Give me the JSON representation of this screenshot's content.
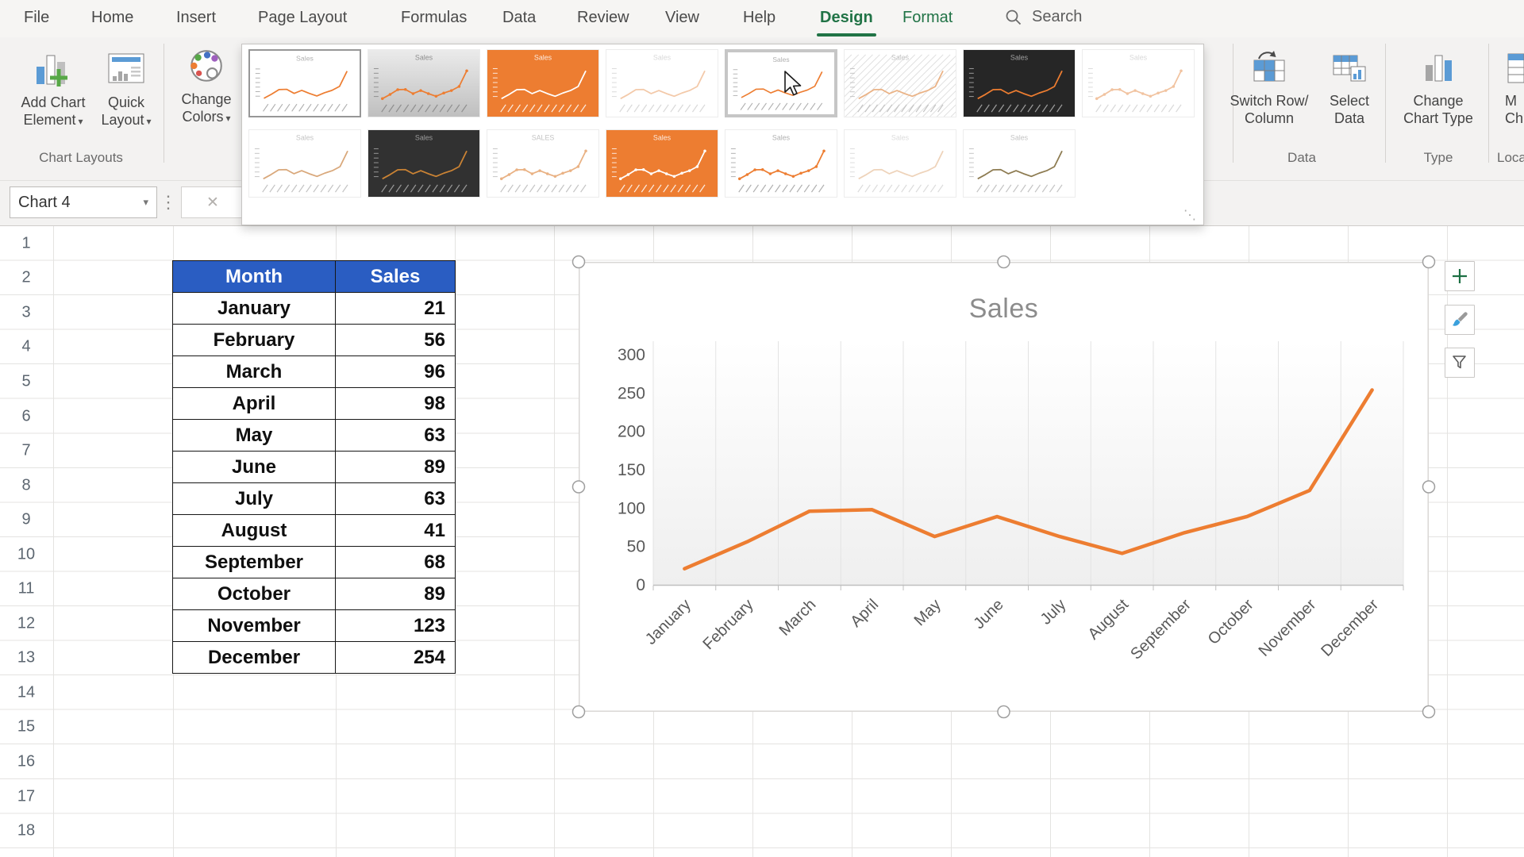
{
  "ribbon": {
    "tabs": [
      {
        "label": "File"
      },
      {
        "label": "Home"
      },
      {
        "label": "Insert"
      },
      {
        "label": "Page Layout"
      },
      {
        "label": "Formulas"
      },
      {
        "label": "Data"
      },
      {
        "label": "Review"
      },
      {
        "label": "View"
      },
      {
        "label": "Help"
      },
      {
        "label": "Design",
        "contextual": true,
        "active": true
      },
      {
        "label": "Format",
        "contextual": true
      }
    ],
    "search_label": "Search",
    "chart_layouts_group": {
      "label": "Chart Layouts",
      "add_chart_element": [
        "Add Chart",
        "Element"
      ],
      "quick_layout": [
        "Quick",
        "Layout"
      ],
      "change_colors": [
        "Change",
        "Colors"
      ]
    },
    "data_group": {
      "label": "Data",
      "switch_row_column": [
        "Switch Row/",
        "Column"
      ],
      "select_data": [
        "Select",
        "Data"
      ]
    },
    "type_group": {
      "label": "Type",
      "change_chart_type": [
        "Change",
        "Chart Type"
      ]
    },
    "location_group": {
      "label": "Loca",
      "move_chart": [
        "M",
        "Ch"
      ]
    }
  },
  "formula_bar": {
    "name_box": "Chart 4"
  },
  "icons": {
    "caret": "▾",
    "dots": "⋮",
    "cancel": "✕",
    "grip": "⋱"
  },
  "style_gallery": {
    "row1": [
      {
        "title": "Sales",
        "bg": "#ffffff",
        "line": "#ED7D31",
        "fg": "#b0b0b0",
        "state": "selected"
      },
      {
        "title": "Sales",
        "bg": "#ebebeb",
        "bg2": "#bfbfbf",
        "line": "#ED7D31",
        "fg": "#8f8f8f",
        "markers": true
      },
      {
        "title": "Sales",
        "bg": "#ED7D31",
        "line": "#ffffff",
        "fg": "rgba(255,255,255,0.85)"
      },
      {
        "title": "Sales",
        "bg": "#ffffff",
        "line": "#f3c9a9",
        "fg": "#d9d9d9"
      },
      {
        "title": "Sales",
        "bg": "#ffffff",
        "line": "#ED7D31",
        "fg": "#b0b0b0",
        "state": "hovered"
      },
      {
        "title": "Sales",
        "bg": "#ffffff",
        "line": "#eab285",
        "fg": "#c4c4c4",
        "hatch": true
      },
      {
        "title": "Sales",
        "bg": "#262626",
        "line": "#ED7D31",
        "fg": "rgba(255,255,255,0.55)"
      },
      {
        "title": "Sales",
        "bg": "#ffffff",
        "line": "#f1c3a0",
        "fg": "#d9d9d9",
        "markers": true
      }
    ],
    "row2": [
      {
        "title": "Sales",
        "bg": "#ffffff",
        "line": "#d9a87b",
        "fg": "#c4c4c4"
      },
      {
        "title": "Sales",
        "bg": "#313131",
        "line": "#cb8334",
        "fg": "rgba(255,255,255,0.5)"
      },
      {
        "title": "SALES",
        "bg": "#ffffff",
        "line": "#e9b183",
        "fg": "#c4c4c4",
        "markers": true
      },
      {
        "title": "Sales",
        "bg": "#ED7D31",
        "line": "#ffffff",
        "fg": "rgba(255,255,255,0.85)",
        "markers": true
      },
      {
        "title": "Sales",
        "bg": "#ffffff",
        "line": "#ED7D31",
        "fg": "#b0b0b0",
        "markers": true
      },
      {
        "title": "Sales",
        "bg": "#ffffff",
        "line": "#eed3ba",
        "fg": "#dcdcdc"
      },
      {
        "title": "Sales",
        "bg": "#ffffff",
        "line": "#8d7b51",
        "fg": "#c4c4c4"
      }
    ]
  },
  "sheet": {
    "row_numbers": [
      1,
      2,
      3,
      4,
      5,
      6,
      7,
      8,
      9,
      10,
      11,
      12,
      13,
      14,
      15,
      16,
      17,
      18
    ]
  },
  "table": {
    "headers": [
      "Month",
      "Sales"
    ],
    "rows": [
      [
        "January",
        21
      ],
      [
        "February",
        56
      ],
      [
        "March",
        96
      ],
      [
        "April",
        98
      ],
      [
        "May",
        63
      ],
      [
        "June",
        89
      ],
      [
        "July",
        63
      ],
      [
        "August",
        41
      ],
      [
        "September",
        68
      ],
      [
        "October",
        89
      ],
      [
        "November",
        123
      ],
      [
        "December",
        254
      ]
    ]
  },
  "chart_data": {
    "type": "line",
    "title": "Sales",
    "categories": [
      "January",
      "February",
      "March",
      "April",
      "May",
      "June",
      "July",
      "August",
      "September",
      "October",
      "November",
      "December"
    ],
    "values": [
      21,
      56,
      96,
      98,
      63,
      89,
      63,
      41,
      68,
      89,
      123,
      254
    ],
    "ylim": [
      0,
      300
    ],
    "yticks": [
      0,
      50,
      100,
      150,
      200,
      250,
      300
    ],
    "series_color": "#ED7D31",
    "title_color": "#8c8c8c",
    "axis_label_color": "#595959",
    "grid": "vertical-category-lines",
    "legend": "none"
  },
  "chart_buttons": [
    {
      "name": "chart-elements-button",
      "icon": "plus-icon"
    },
    {
      "name": "chart-styles-button",
      "icon": "brush-icon"
    },
    {
      "name": "chart-filters-button",
      "icon": "funnel-icon"
    }
  ],
  "colors": {
    "accent_green": "#217346",
    "table_header_bg": "#2a5dc2",
    "series_orange": "#ED7D31",
    "gridline": "#e4e3e1"
  }
}
